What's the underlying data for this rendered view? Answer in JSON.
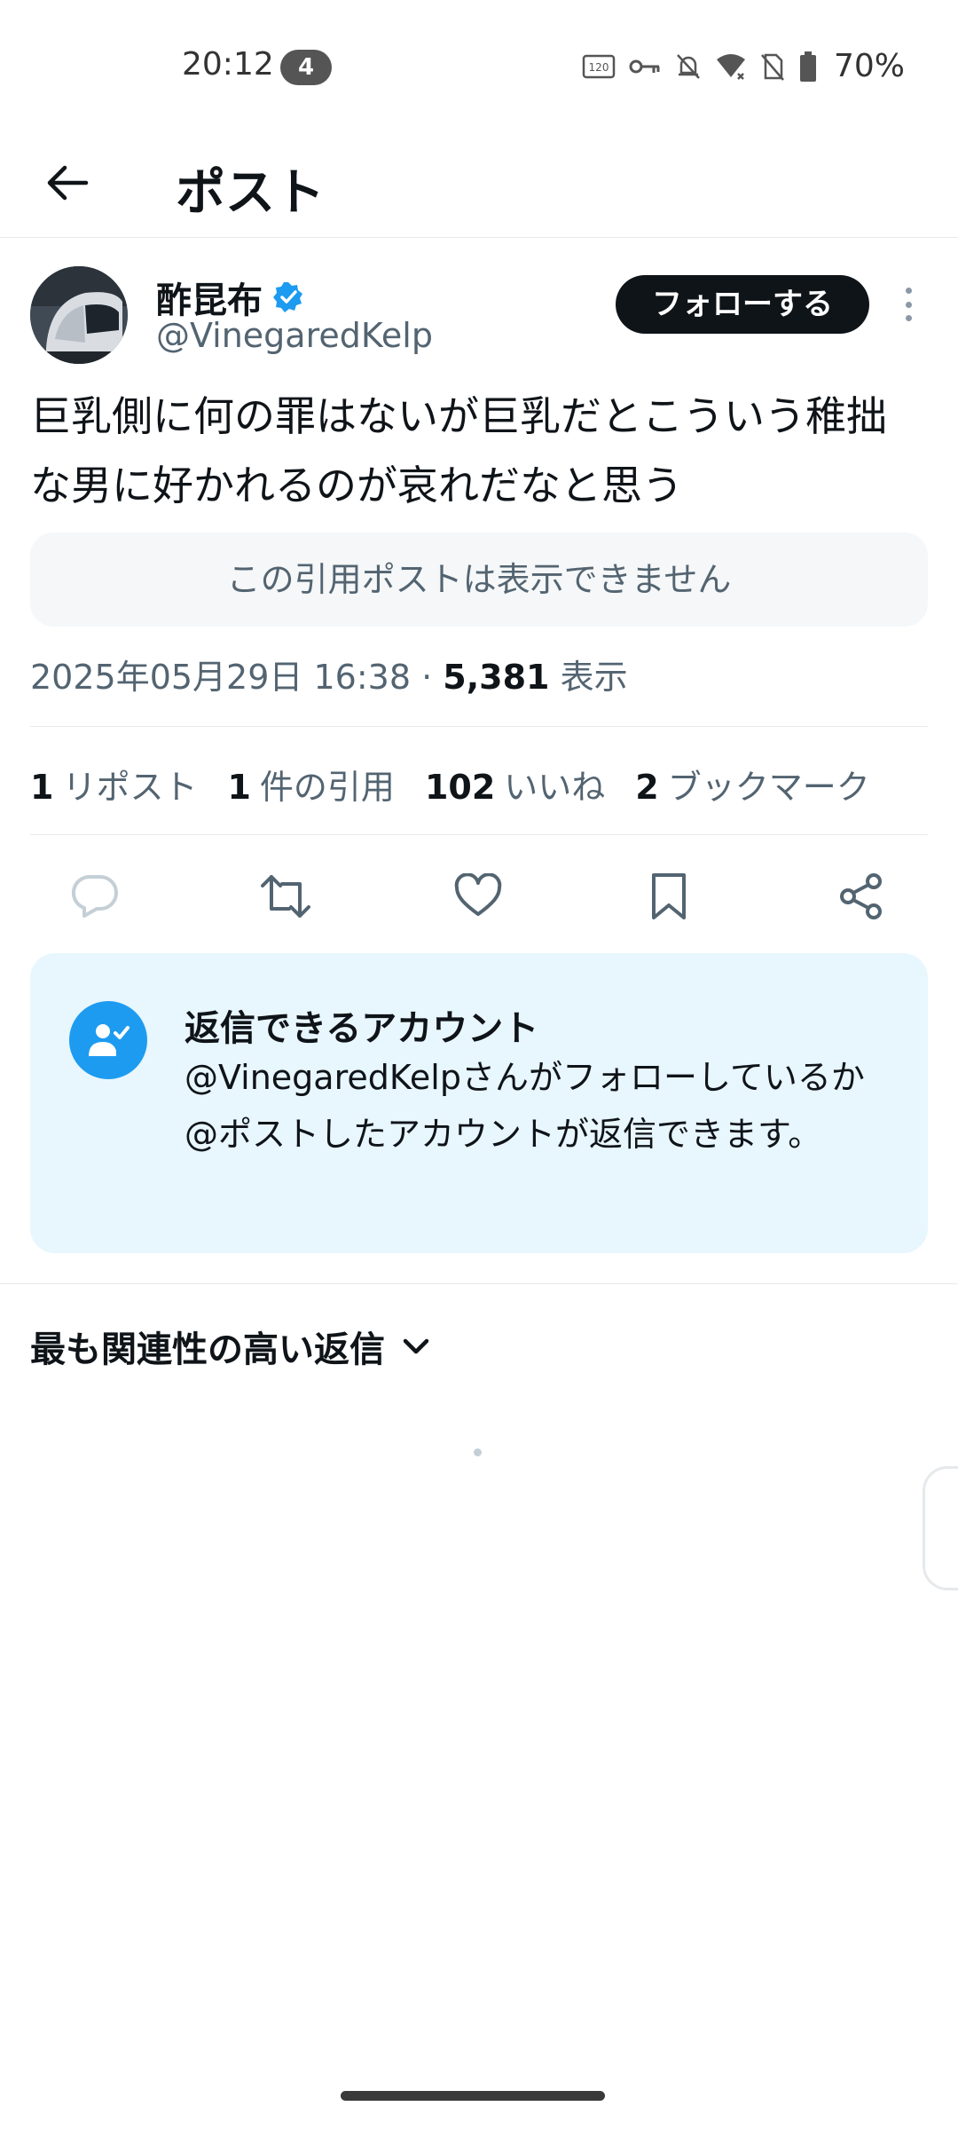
{
  "status_bar": {
    "time": "20:12",
    "notification_count": "4",
    "battery_percent": "70%",
    "icons": [
      "120hz-icon",
      "vpn-key-icon",
      "bell-off-icon",
      "wifi-icon",
      "no-sim-icon",
      "battery-icon"
    ]
  },
  "header": {
    "title": "ポスト",
    "back_icon": "arrow-left-icon"
  },
  "post": {
    "author": {
      "display_name": "酢昆布",
      "handle": "@VinegaredKelp",
      "verified": true
    },
    "follow_label": "フォローする",
    "text": "巨乳側に何の罪はないが巨乳だとこういう稚拙な男に好かれるのが哀れだなと思う",
    "quote_unavailable": "この引用ポストは表示できません",
    "timestamp": "2025年05月29日 16:38",
    "separator": " · ",
    "views": "5,381",
    "views_label": "表示",
    "stats": {
      "reposts": "1",
      "reposts_label": "リポスト",
      "quotes": "1",
      "quotes_label": "件の引用",
      "likes": "102",
      "likes_label": "いいね",
      "bookmarks": "2",
      "bookmarks_label": "ブックマーク"
    },
    "actions": [
      "reply-icon",
      "repost-icon",
      "like-icon",
      "bookmark-icon",
      "share-icon"
    ]
  },
  "reply_restriction": {
    "title": "返信できるアカウント",
    "description": "@VinegaredKelpさんがフォローしているか@ポストしたアカウントが返信できます。"
  },
  "replies": {
    "sort_label": "最も関連性の高い返信"
  },
  "colors": {
    "accent": "#1d9bf0",
    "text": "#0f1419",
    "secondary_text": "#536471",
    "reply_card_bg": "#e8f6fd"
  }
}
